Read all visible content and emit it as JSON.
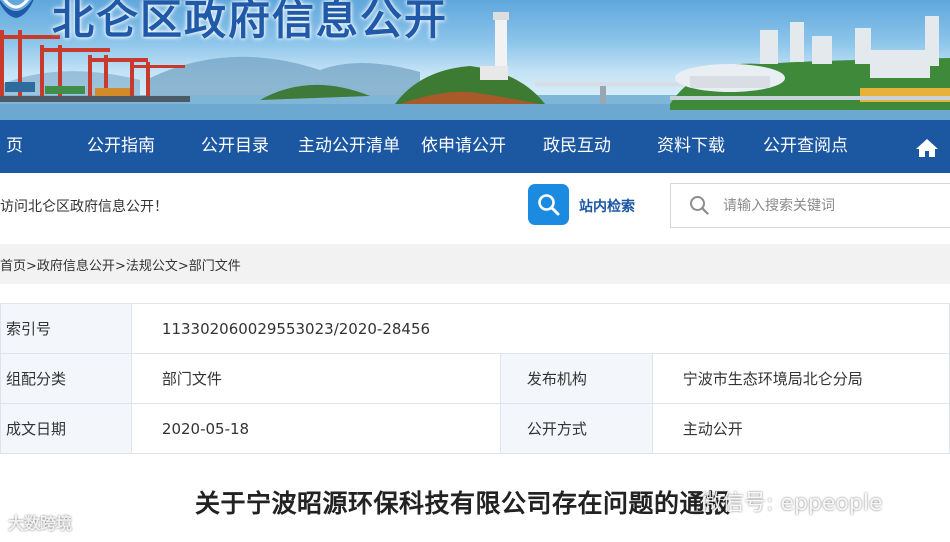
{
  "header": {
    "site_title": "北仑区政府信息公开"
  },
  "nav": {
    "items": [
      {
        "label": "页"
      },
      {
        "label": "公开指南"
      },
      {
        "label": "公开目录"
      },
      {
        "label": "主动公开清单"
      },
      {
        "label": "依申请公开"
      },
      {
        "label": "政民互动"
      },
      {
        "label": "资料下载"
      },
      {
        "label": "公开查阅点"
      }
    ],
    "home_icon": "home-icon"
  },
  "welcome_text": "访问北仑区政府信息公开！",
  "search": {
    "button_label": "站内检索",
    "placeholder": "请输入搜索关键词",
    "value": ""
  },
  "breadcrumb": {
    "items": [
      "首页",
      "政府信息公开",
      "法规公文",
      "部门文件"
    ],
    "separator": ">"
  },
  "info_table": {
    "index_label": "索引号",
    "index_value": "113302060029553023/2020-28456",
    "category_label": "组配分类",
    "category_value": "部门文件",
    "publisher_label": "发布机构",
    "publisher_value": "宁波市生态环境局北仑分局",
    "date_label": "成文日期",
    "date_value": "2020-05-18",
    "method_label": "公开方式",
    "method_value": "主动公开"
  },
  "document": {
    "title": "关于宁波昭源环保科技有限公司存在问题的通报"
  },
  "watermarks": {
    "left": "大数跨境",
    "right": "微信号: eppeople"
  },
  "colors": {
    "nav_bg": "#1c58a2",
    "title_blue": "#1f59a8",
    "search_button": "#1a8be0",
    "table_label_bg": "#f3f6fb",
    "crumb_bg": "#f2f2f2"
  }
}
